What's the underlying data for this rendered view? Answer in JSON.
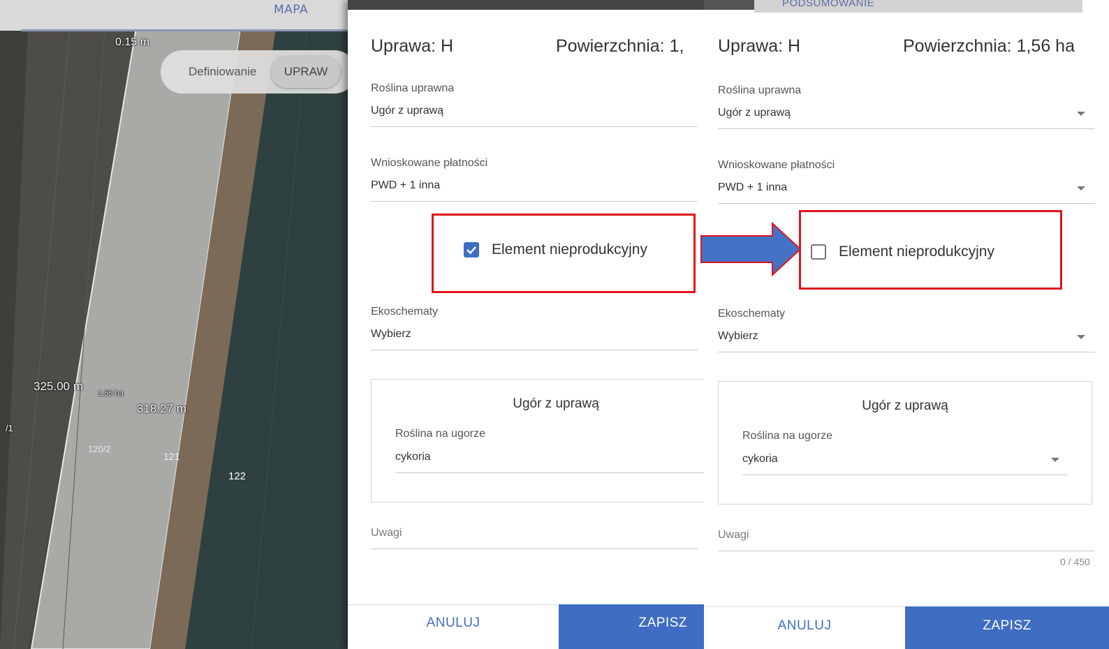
{
  "map": {
    "tab_label": "MAPA",
    "definiowanie_label": "Definiowanie",
    "upraw_button": "UPRAW",
    "labels": {
      "distance_top": "0.15 m",
      "distance_left": "325.00 m",
      "area": "1.56 ha",
      "distance_right": "318.27 m",
      "parcel_edge": "/1",
      "parcel_120_2": "120/2",
      "parcel_121": "121",
      "parcel_122": "122"
    }
  },
  "top_right_tab": "PODSUMOWANIE",
  "colors": {
    "accent": "#3f6dc3",
    "highlight_box": "#e0141b",
    "arrow_fill": "#4472c4",
    "arrow_stroke": "#e0141b"
  },
  "left_panel": {
    "crop_label": "Uprawa: H",
    "area_label": "Powierzchnia: 1,",
    "plant_label": "Roślina uprawna",
    "plant_value": "Ugór z uprawą",
    "payments_label": "Wnioskowane płatności",
    "payments_value": "PWD + 1 inna",
    "nonproductive_label": "Element nieprodukcyjny",
    "nonproductive_checked": true,
    "ecoschemes_label": "Ekoschematy",
    "ecoschemes_value": "Wybierz",
    "fallow_card_title": "Ugór z uprawą",
    "fallow_plant_label": "Roślina na ugorze",
    "fallow_plant_value": "cykoria",
    "notes_label": "Uwagi",
    "cancel_button": "ANULUJ",
    "save_button": "ZAPISZ"
  },
  "right_panel": {
    "crop_label": "Uprawa: H",
    "area_label": "Powierzchnia: 1,56 ha",
    "plant_label": "Roślina uprawna",
    "plant_value": "Ugór z uprawą",
    "payments_label": "Wnioskowane płatności",
    "payments_value": "PWD + 1 inna",
    "nonproductive_label": "Element nieprodukcyjny",
    "nonproductive_checked": false,
    "ecoschemes_label": "Ekoschematy",
    "ecoschemes_value": "Wybierz",
    "fallow_card_title": "Ugór z uprawą",
    "fallow_plant_label": "Roślina na ugorze",
    "fallow_plant_value": "cykoria",
    "notes_label": "Uwagi",
    "notes_counter": "0 / 450",
    "cancel_button": "ANULUJ",
    "save_button": "ZAPISZ"
  }
}
